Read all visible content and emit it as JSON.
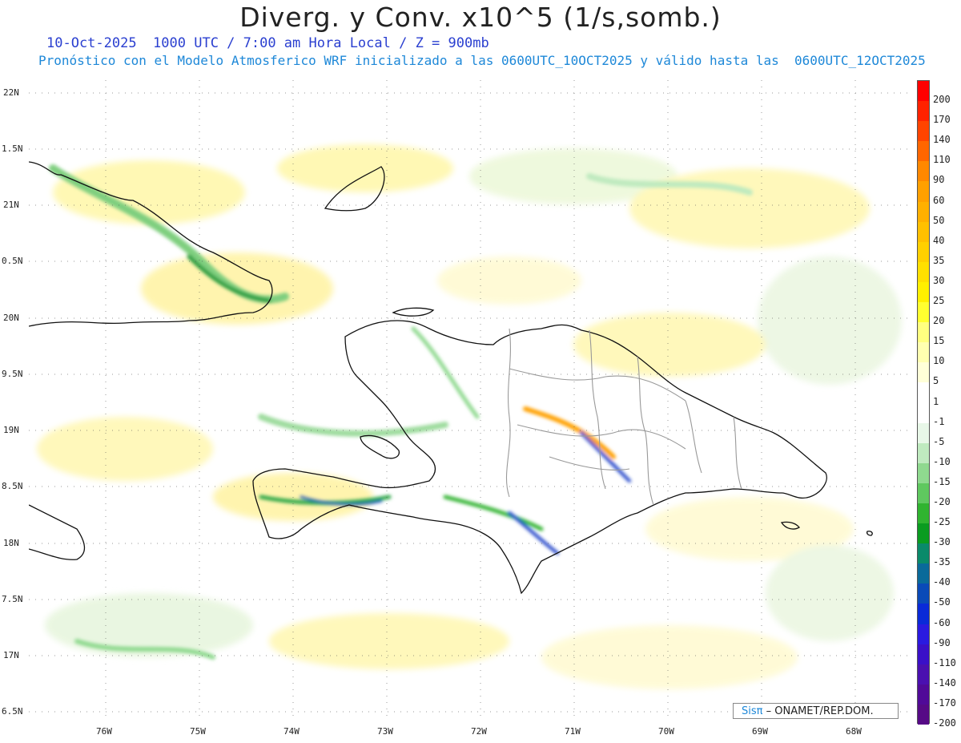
{
  "title": "Diverg. y Conv. x10^5 (1/s,somb.)",
  "subtitle_line1": "10-Oct-2025  1000 UTC / 7:00 am Hora Local / Z = 900mb",
  "subtitle_line2": "Pronóstico con el Modelo Atmosferico WRF inicializado a las 0600UTC_10OCT2025 y válido hasta las  0600UTC_12OCT2025",
  "credit": {
    "logo": "Sisπ",
    "text": "– ONAMET/REP.DOM."
  },
  "lat_labels": [
    "22N",
    "1.5N",
    "21N",
    "0.5N",
    "20N",
    "9.5N",
    "19N",
    "8.5N",
    "18N",
    "7.5N",
    "17N",
    "6.5N"
  ],
  "lon_labels": [
    "76W",
    "75W",
    "74W",
    "73W",
    "72W",
    "71W",
    "70W",
    "69W",
    "68W"
  ],
  "colorbar": {
    "labels": [
      "200",
      "170",
      "140",
      "110",
      "90",
      "60",
      "50",
      "40",
      "35",
      "30",
      "25",
      "20",
      "15",
      "10",
      "5",
      "1",
      "-1",
      "-5",
      "-10",
      "-15",
      "-20",
      "-25",
      "-30",
      "-35",
      "-40",
      "-50",
      "-60",
      "-90",
      "-110",
      "-140",
      "-170",
      "-200"
    ],
    "colors": [
      "#ff0000",
      "#ff2200",
      "#ff4400",
      "#ff6600",
      "#ff8800",
      "#ffa000",
      "#ffb000",
      "#ffc000",
      "#ffd000",
      "#ffe000",
      "#fff000",
      "#ffff30",
      "#ffff80",
      "#ffffb0",
      "#ffffd8",
      "#ffffff",
      "#ffffff",
      "#e8f7e8",
      "#bfeabf",
      "#8fd98f",
      "#5fc85f",
      "#30b430",
      "#0a9c20",
      "#0a8a6a",
      "#0a6a9a",
      "#0a4ab8",
      "#0a2ad8",
      "#2a1ae0",
      "#3a10c8",
      "#4a10b0",
      "#500a98",
      "#560a86"
    ]
  }
}
